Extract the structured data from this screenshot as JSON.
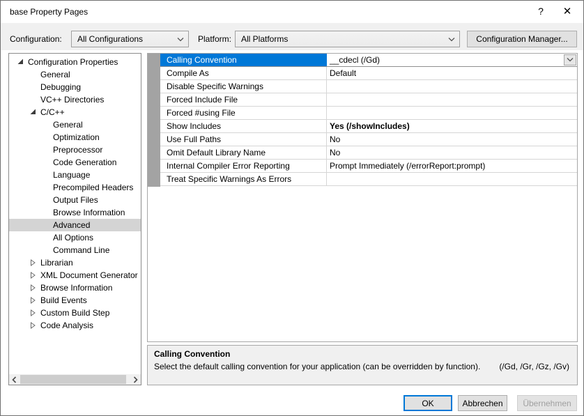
{
  "window": {
    "title": "base Property Pages"
  },
  "icons": {
    "help": "?",
    "close": "✕"
  },
  "toolbar": {
    "configuration_label": "Configuration:",
    "configuration_value": "All Configurations",
    "platform_label": "Platform:",
    "platform_value": "All Platforms",
    "configuration_manager_label": "Configuration Manager..."
  },
  "tree": {
    "items": [
      {
        "label": "Configuration Properties",
        "level": 0,
        "expander": "expanded",
        "selected": false
      },
      {
        "label": "General",
        "level": 1,
        "expander": "none",
        "selected": false
      },
      {
        "label": "Debugging",
        "level": 1,
        "expander": "none",
        "selected": false
      },
      {
        "label": "VC++ Directories",
        "level": 1,
        "expander": "none",
        "selected": false
      },
      {
        "label": "C/C++",
        "level": 1,
        "expander": "expanded",
        "selected": false
      },
      {
        "label": "General",
        "level": 2,
        "expander": "none",
        "selected": false
      },
      {
        "label": "Optimization",
        "level": 2,
        "expander": "none",
        "selected": false
      },
      {
        "label": "Preprocessor",
        "level": 2,
        "expander": "none",
        "selected": false
      },
      {
        "label": "Code Generation",
        "level": 2,
        "expander": "none",
        "selected": false
      },
      {
        "label": "Language",
        "level": 2,
        "expander": "none",
        "selected": false
      },
      {
        "label": "Precompiled Headers",
        "level": 2,
        "expander": "none",
        "selected": false
      },
      {
        "label": "Output Files",
        "level": 2,
        "expander": "none",
        "selected": false
      },
      {
        "label": "Browse Information",
        "level": 2,
        "expander": "none",
        "selected": false
      },
      {
        "label": "Advanced",
        "level": 2,
        "expander": "none",
        "selected": true
      },
      {
        "label": "All Options",
        "level": 2,
        "expander": "none",
        "selected": false
      },
      {
        "label": "Command Line",
        "level": 2,
        "expander": "none",
        "selected": false
      },
      {
        "label": "Librarian",
        "level": 1,
        "expander": "collapsed",
        "selected": false
      },
      {
        "label": "XML Document Generator",
        "level": 1,
        "expander": "collapsed",
        "selected": false
      },
      {
        "label": "Browse Information",
        "level": 1,
        "expander": "collapsed",
        "selected": false
      },
      {
        "label": "Build Events",
        "level": 1,
        "expander": "collapsed",
        "selected": false
      },
      {
        "label": "Custom Build Step",
        "level": 1,
        "expander": "collapsed",
        "selected": false
      },
      {
        "label": "Code Analysis",
        "level": 1,
        "expander": "collapsed",
        "selected": false
      }
    ]
  },
  "property_grid": {
    "rows": [
      {
        "name": "Calling Convention",
        "value": "__cdecl (/Gd)",
        "selected": true,
        "bold": false,
        "editor": "dropdown"
      },
      {
        "name": "Compile As",
        "value": "Default",
        "selected": false,
        "bold": false,
        "editor": "none"
      },
      {
        "name": "Disable Specific Warnings",
        "value": "",
        "selected": false,
        "bold": false,
        "editor": "none"
      },
      {
        "name": "Forced Include File",
        "value": "",
        "selected": false,
        "bold": false,
        "editor": "none"
      },
      {
        "name": "Forced #using File",
        "value": "",
        "selected": false,
        "bold": false,
        "editor": "none"
      },
      {
        "name": "Show Includes",
        "value": "Yes (/showIncludes)",
        "selected": false,
        "bold": true,
        "editor": "none"
      },
      {
        "name": "Use Full Paths",
        "value": "No",
        "selected": false,
        "bold": false,
        "editor": "none"
      },
      {
        "name": "Omit Default Library Name",
        "value": "No",
        "selected": false,
        "bold": false,
        "editor": "none"
      },
      {
        "name": "Internal Compiler Error Reporting",
        "value": "Prompt Immediately (/errorReport:prompt)",
        "selected": false,
        "bold": false,
        "editor": "none"
      },
      {
        "name": "Treat Specific Warnings As Errors",
        "value": "",
        "selected": false,
        "bold": false,
        "editor": "none"
      }
    ]
  },
  "help_panel": {
    "title": "Calling Convention",
    "description": "Select the default calling convention for your application (can be overridden by function).",
    "switches": "(/Gd, /Gr, /Gz, /Gv)"
  },
  "footer": {
    "ok_label": "OK",
    "cancel_label": "Abbrechen",
    "apply_label": "Übernehmen"
  },
  "colors": {
    "selection_blue": "#0078d7",
    "tree_selection_gray": "#d4d4d4",
    "grid_gutter_gray": "#a3a3a3",
    "toolbar_bg": "#f0f0f0"
  }
}
